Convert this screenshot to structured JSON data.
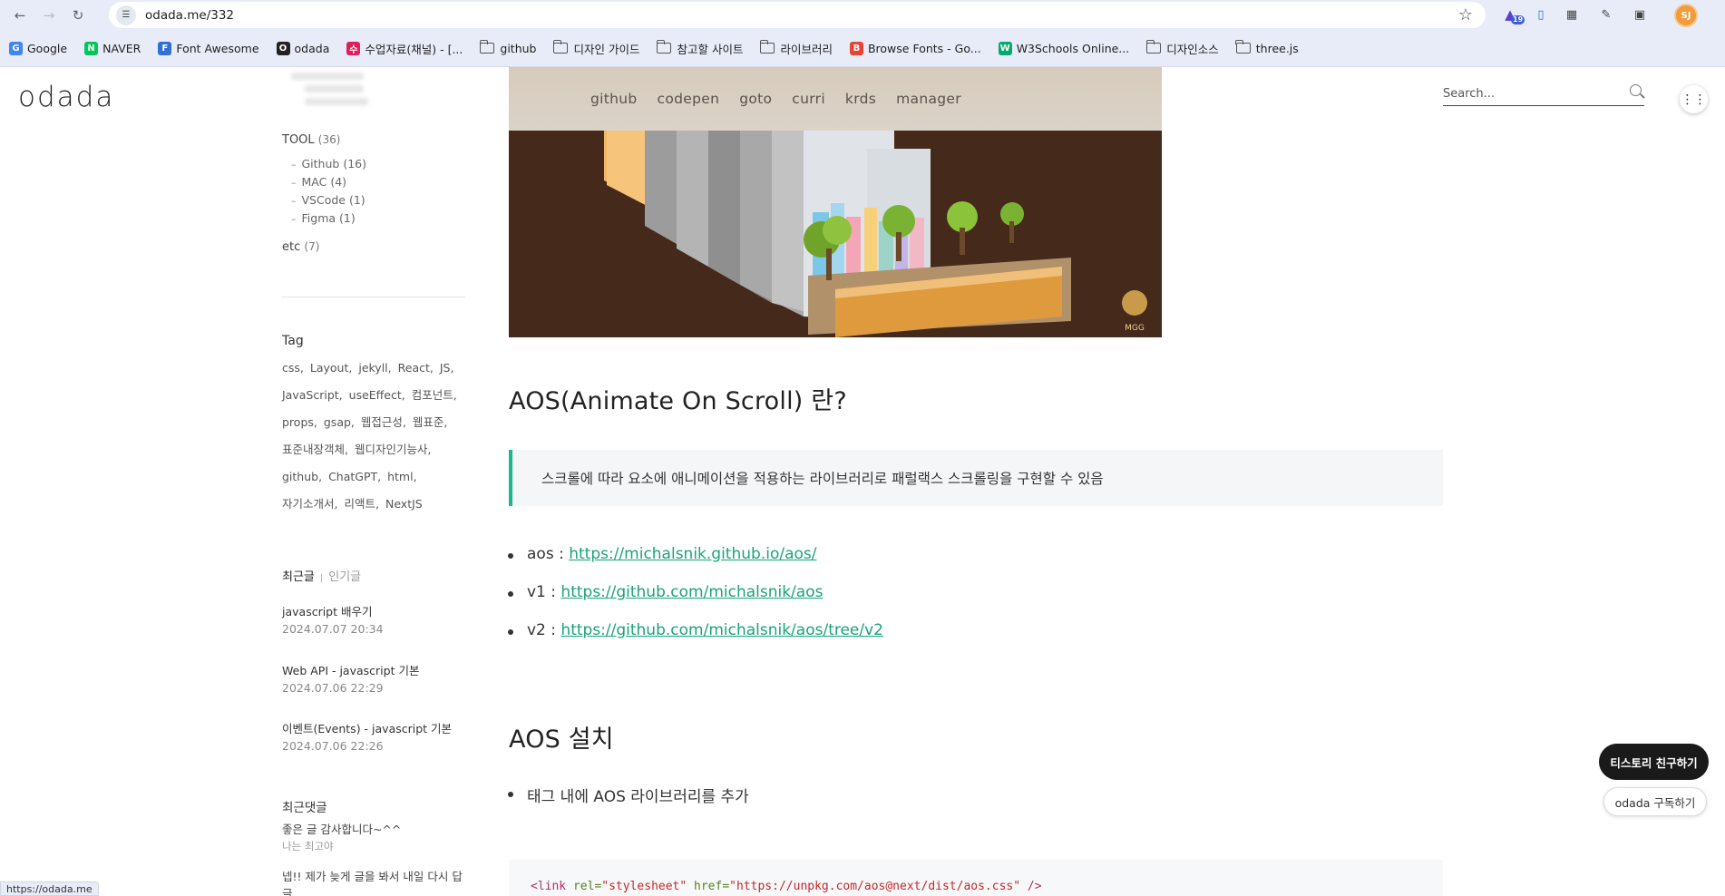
{
  "browser": {
    "url": "odada.me/332",
    "extension_badge": "19",
    "profile_initials": "SJ",
    "status_url": "https://odada.me"
  },
  "bookmarks": [
    {
      "label": "Google",
      "icon": "google-icon",
      "type": "site",
      "color": "#4285f4"
    },
    {
      "label": "NAVER",
      "icon": "naver-icon",
      "type": "site",
      "color": "#03c75a"
    },
    {
      "label": "Font Awesome",
      "icon": "flag-icon",
      "type": "site",
      "color": "#2f6fd6"
    },
    {
      "label": "odada",
      "icon": "odada-icon",
      "type": "site",
      "color": "#222222"
    },
    {
      "label": "수업자료(채널) - [...",
      "icon": "slack-icon",
      "type": "site",
      "color": "#e01e5a"
    },
    {
      "label": "github",
      "icon": "folder-icon",
      "type": "folder"
    },
    {
      "label": "디자인 가이드",
      "icon": "folder-icon",
      "type": "folder"
    },
    {
      "label": "참고할 사이트",
      "icon": "folder-icon",
      "type": "folder"
    },
    {
      "label": "라이브러리",
      "icon": "folder-icon",
      "type": "folder"
    },
    {
      "label": "Browse Fonts - Go...",
      "icon": "google-fonts-icon",
      "type": "site",
      "color": "#ea4335"
    },
    {
      "label": "W3Schools Online...",
      "icon": "w3schools-icon",
      "type": "site",
      "color": "#04aa6d"
    },
    {
      "label": "디자인소스",
      "icon": "folder-icon",
      "type": "folder"
    },
    {
      "label": "three.js",
      "icon": "folder-icon",
      "type": "folder"
    }
  ],
  "site": {
    "logo": "odada",
    "nav": [
      "github",
      "codepen",
      "goto",
      "curri",
      "krds",
      "manager"
    ],
    "search_placeholder": "Search..."
  },
  "sidebar": {
    "categories": [
      {
        "label": "TOOL",
        "count": "(36)"
      },
      {
        "label": "etc",
        "count": "(7)"
      }
    ],
    "subcategories": [
      "Github (16)",
      "MAC (4)",
      "VSCode (1)",
      "Figma (1)"
    ],
    "tag_title": "Tag",
    "tags": [
      "css,",
      "Layout,",
      "jekyll,",
      "React,",
      "JS,",
      "JavaScript,",
      "useEffect,",
      "컴포넌트,",
      "props,",
      "gsap,",
      "웹접근성,",
      "웹표준,",
      "표준내장객체,",
      "웹디자인기능사,",
      "github,",
      "ChatGPT,",
      "html,",
      "자기소개서,",
      "리액트,",
      "NextJS"
    ],
    "tab_active": "최근글",
    "tab_inactive": "인기글",
    "recent_posts": [
      {
        "title": "javascript 배우기",
        "date": "2024.07.07 20:34"
      },
      {
        "title": "Web API - javascript 기본",
        "date": "2024.07.06 22:29"
      },
      {
        "title": "이벤트(Events) - javascript 기본",
        "date": "2024.07.06 22:26"
      }
    ],
    "comments_title": "최근댓글",
    "comments": [
      {
        "text": "좋은 글 감사합니다~^^",
        "author": "나는 최고야"
      },
      {
        "text": "넵!! 제가 늦게 글을 봐서 내일 다시 답글",
        "author": ""
      }
    ]
  },
  "article": {
    "hero_watermark": "MGG",
    "heading1": "AOS(Animate On Scroll) 란?",
    "quote": "스크롤에 따라 요소에 애니메이션을 적용하는 라이브러리로 패럴랙스 스크롤링을 구현할 수 있음",
    "links": [
      {
        "label": "aos : ",
        "url": "https://michalsnik.github.io/aos/"
      },
      {
        "label": "v1 : ",
        "url": "https://github.com/michalsnik/aos"
      },
      {
        "label": "v2 : ",
        "url": "https://github.com/michalsnik/aos/tree/v2"
      }
    ],
    "heading2": "AOS 설치",
    "install_item": "태그 내에 AOS 라이브러리를 추가",
    "code": {
      "tag_open": "<link",
      "attr1": "rel=",
      "val1": "\"stylesheet\"",
      "attr2": "href=",
      "val2": "\"https://unpkg.com/aos@next/dist/aos.css\"",
      "tag_close": "/>"
    }
  },
  "floating": {
    "friend_button": "티스토리 친구하기",
    "subscribe_button": "odada 구독하기"
  },
  "colors": {
    "accent": "#1ab88f",
    "link": "#1aa37a",
    "hero_bg": "#45291a"
  }
}
